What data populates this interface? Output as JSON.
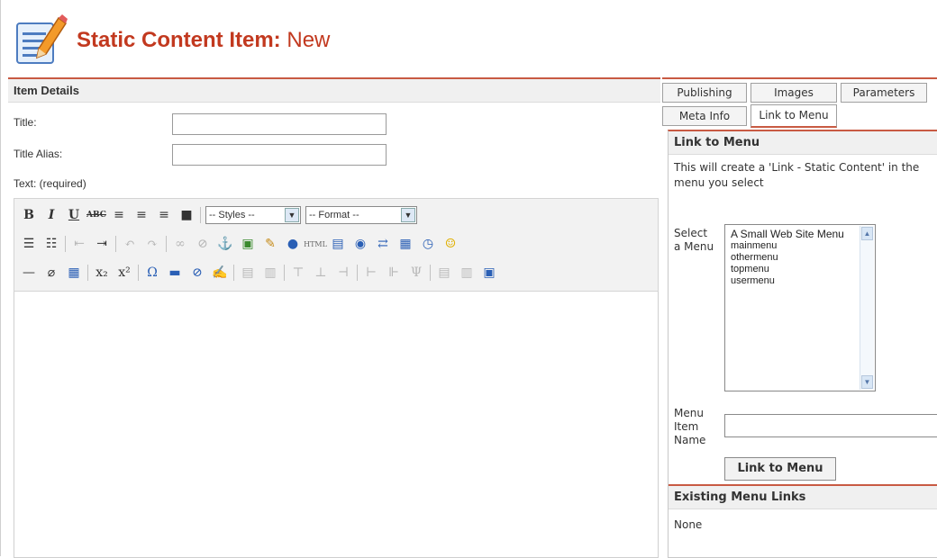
{
  "header": {
    "title": "Static Content Item:",
    "subtitle": "New"
  },
  "item_details": {
    "heading": "Item Details",
    "title_label": "Title:",
    "title_value": "",
    "alias_label": "Title Alias:",
    "alias_value": "",
    "text_label": "Text: (required)"
  },
  "editor": {
    "styles_select": "-- Styles --",
    "format_select": "-- Format --"
  },
  "tabs": {
    "row1": [
      "Publishing",
      "Images",
      "Parameters"
    ],
    "row2": [
      "Meta Info",
      "Link to Menu"
    ],
    "active": "Link to Menu"
  },
  "link_to_menu": {
    "heading": "Link to Menu",
    "description": "This will create a 'Link - Static Content' in the menu you select",
    "select_label": "Select a Menu",
    "menus": [
      "A Small Web Site Menu",
      "mainmenu",
      "othermenu",
      "topmenu",
      "usermenu"
    ],
    "item_name_label": "Menu Item Name",
    "item_name_value": "",
    "button_label": "Link to Menu"
  },
  "existing_links": {
    "heading": "Existing Menu Links",
    "value": "None"
  },
  "colors": {
    "accent": "#c2391f",
    "rule": "#c85a43",
    "section_bg": "#f0f0f0"
  }
}
